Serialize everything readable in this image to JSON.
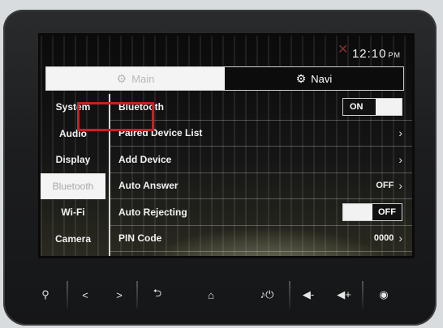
{
  "status": {
    "time": "12:10",
    "ampm": "PM"
  },
  "tabs": [
    {
      "label": "Main",
      "icon": "gears-icon"
    },
    {
      "label": "Navi",
      "icon": "gears-icon"
    }
  ],
  "sidebar": {
    "items": [
      {
        "label": "System"
      },
      {
        "label": "Audio"
      },
      {
        "label": "Display"
      },
      {
        "label": "Bluetooth",
        "active": true
      },
      {
        "label": "Wi-Fi"
      },
      {
        "label": "Camera"
      }
    ]
  },
  "bluetooth": {
    "rows": [
      {
        "label": "Bluetooth",
        "value": "ON",
        "control": "toggle-on"
      },
      {
        "label": "Paired Device List",
        "value": "",
        "control": "chevron"
      },
      {
        "label": "Add Device",
        "value": "",
        "control": "chevron"
      },
      {
        "label": "Auto Answer",
        "value": "OFF",
        "control": "value-chevron"
      },
      {
        "label": "Auto Rejecting",
        "value": "OFF",
        "control": "toggle-off"
      },
      {
        "label": "PIN Code",
        "value": "0000",
        "control": "value-chevron"
      }
    ]
  },
  "annotation": {
    "highlight_color": "#cc1f1f",
    "highlighted_row": "Add Device"
  },
  "hardware_buttons": [
    {
      "name": "location-pin-icon",
      "glyph": "⚲"
    },
    {
      "name": "prev-icon",
      "glyph": "<"
    },
    {
      "name": "next-icon",
      "glyph": ">"
    },
    {
      "name": "back-icon",
      "glyph": "⮌"
    },
    {
      "name": "home-icon",
      "glyph": "⌂"
    },
    {
      "name": "music-power-icon",
      "glyph": "♪⏻"
    },
    {
      "name": "volume-down-icon",
      "glyph": "◀-"
    },
    {
      "name": "volume-up-icon",
      "glyph": "◀+"
    },
    {
      "name": "nav-circle-icon",
      "glyph": "◉"
    }
  ]
}
